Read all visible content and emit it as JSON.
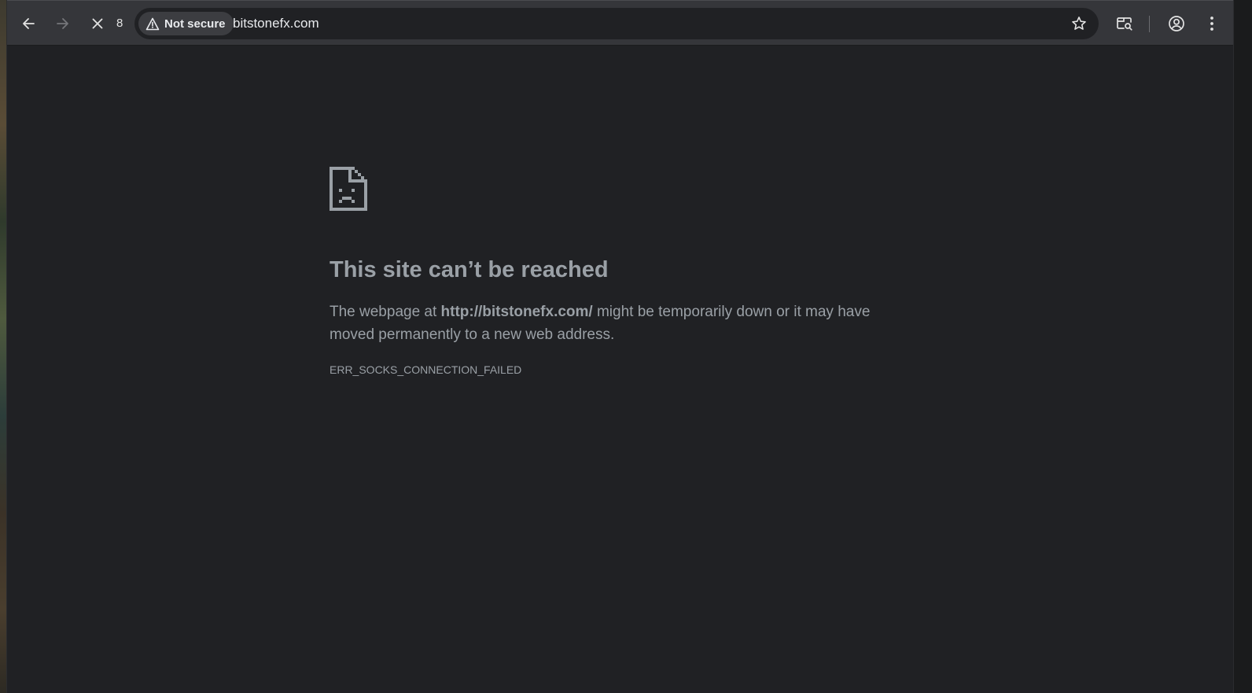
{
  "browser": {
    "loading_count": "8",
    "security_label": "Not secure",
    "url": "bitstonefx.com",
    "icons": {
      "back": "back-arrow-icon",
      "forward": "forward-arrow-icon",
      "stop": "close-icon",
      "warning": "warning-triangle-icon",
      "bookmark": "star-icon",
      "tab_search": "tab-search-icon",
      "profile": "profile-icon",
      "menu": "more-vertical-icon"
    }
  },
  "error_page": {
    "title": "This site can’t be reached",
    "desc_prefix": "The webpage at ",
    "desc_url": "http://bitstonefx.com/",
    "desc_suffix": " might be temporarily down or it may have moved permanently to a new web address.",
    "error_code": "ERR_SOCKS_CONNECTION_FAILED"
  },
  "colors": {
    "page_background": "#202124",
    "toolbar_background": "#35363a",
    "text_secondary": "#9aa0a6",
    "text_primary": "#e8eaed"
  }
}
